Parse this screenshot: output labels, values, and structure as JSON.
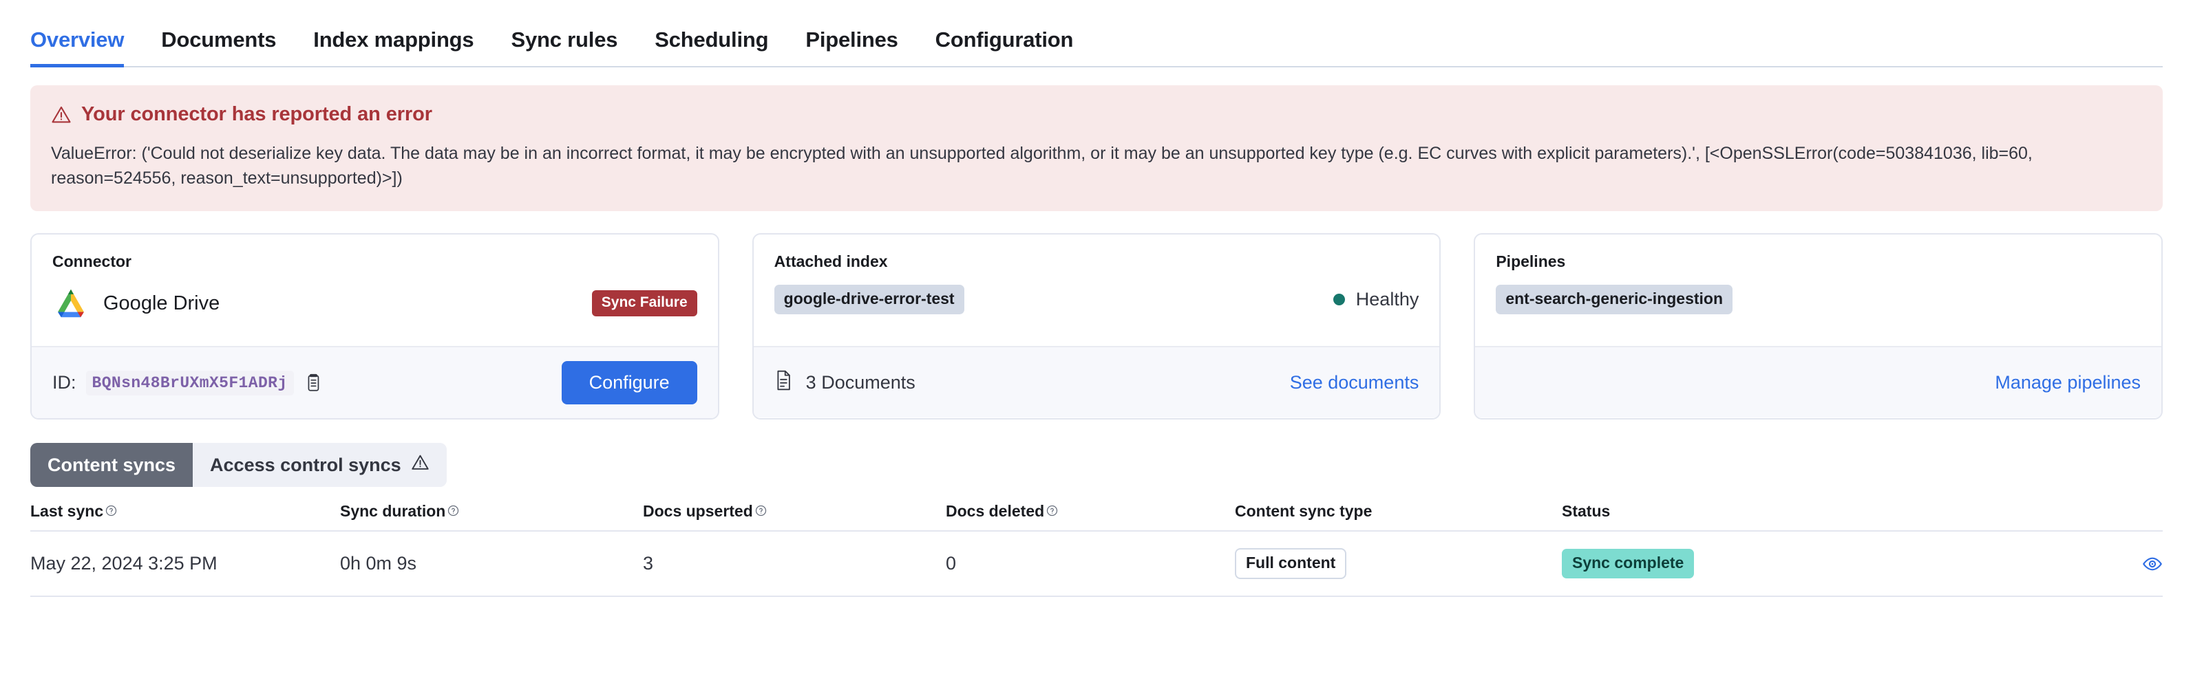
{
  "tabs": [
    {
      "label": "Overview",
      "active": true
    },
    {
      "label": "Documents",
      "active": false
    },
    {
      "label": "Index mappings",
      "active": false
    },
    {
      "label": "Sync rules",
      "active": false
    },
    {
      "label": "Scheduling",
      "active": false
    },
    {
      "label": "Pipelines",
      "active": false
    },
    {
      "label": "Configuration",
      "active": false
    }
  ],
  "error_callout": {
    "icon": "warning-triangle-icon",
    "title": "Your connector has reported an error",
    "message": "ValueError: ('Could not deserialize key data. The data may be in an incorrect format, it may be encrypted with an unsupported algorithm, or it may be an unsupported key type (e.g. EC curves with explicit parameters).', [<OpenSSLError(code=503841036, lib=60, reason=524556, reason_text=unsupported)>])",
    "background_color": "#f8e9e9",
    "title_color": "#a8353a"
  },
  "cards": {
    "connector": {
      "label": "Connector",
      "name": "Google Drive",
      "logo_icon": "google-drive-icon",
      "status_badge": "Sync Failure",
      "status_badge_color": "#a8353a",
      "id_label": "ID:",
      "id_value": "BQNsn48BrUXmX5F1ADRj",
      "copy_icon": "copy-icon",
      "configure_button": "Configure",
      "configure_button_color": "#2f6ee4"
    },
    "attached_index": {
      "label": "Attached index",
      "index_name": "google-drive-error-test",
      "health_status": "Healthy",
      "health_color": "#17776c",
      "documents_icon": "document-icon",
      "documents_count": "3 Documents",
      "see_documents_link": "See documents"
    },
    "pipelines": {
      "label": "Pipelines",
      "pipeline_name": "ent-search-generic-ingestion",
      "manage_link": "Manage pipelines"
    }
  },
  "sync_tabs": [
    {
      "label": "Content syncs",
      "selected": true,
      "warning": false
    },
    {
      "label": "Access control syncs",
      "selected": false,
      "warning": true
    }
  ],
  "table": {
    "headers": [
      {
        "label": "Last sync",
        "help": true
      },
      {
        "label": "Sync duration",
        "help": true
      },
      {
        "label": "Docs upserted",
        "help": true
      },
      {
        "label": "Docs deleted",
        "help": true
      },
      {
        "label": "Content sync type",
        "help": false
      },
      {
        "label": "Status",
        "help": false
      }
    ],
    "rows": [
      {
        "last_sync": "May 22, 2024 3:25 PM",
        "sync_duration": "0h 0m 9s",
        "docs_upserted": "3",
        "docs_deleted": "0",
        "content_sync_type": "Full content",
        "status": "Sync complete",
        "status_color": "#7ddcd0",
        "action_icon": "eye-icon"
      }
    ]
  }
}
